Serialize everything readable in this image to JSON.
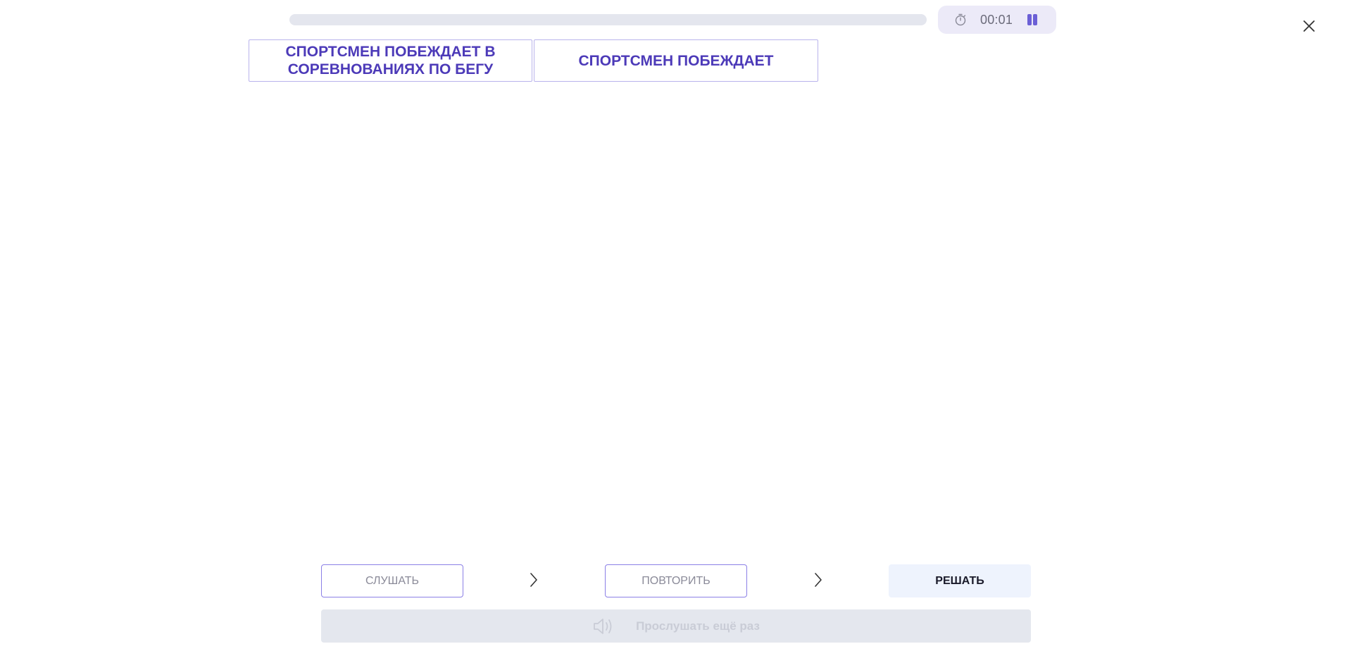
{
  "progress": {
    "fraction": 0.0
  },
  "timer": {
    "time": "00:01",
    "clock_icon": "stopwatch-icon",
    "pause_icon": "pause-icon"
  },
  "close_icon": "close-icon",
  "cards": [
    {
      "text": "СПОРТСМЕН ПОБЕЖДАЕТ В СОРЕВНОВАНИЯХ ПО БЕГУ"
    },
    {
      "text": "СПОРТСМЕН ПОБЕЖДАЕТ"
    }
  ],
  "steps": {
    "listen": "СЛУШАТЬ",
    "repeat": "ПОВТОРИТЬ",
    "solve": "РЕШАТЬ"
  },
  "replay": {
    "label": "Прослушать ещё раз",
    "icon": "speaker-icon"
  },
  "colors": {
    "accent": "#6b5fd6",
    "card_text": "#4c3ab8",
    "card_border": "#b9b3ec"
  }
}
